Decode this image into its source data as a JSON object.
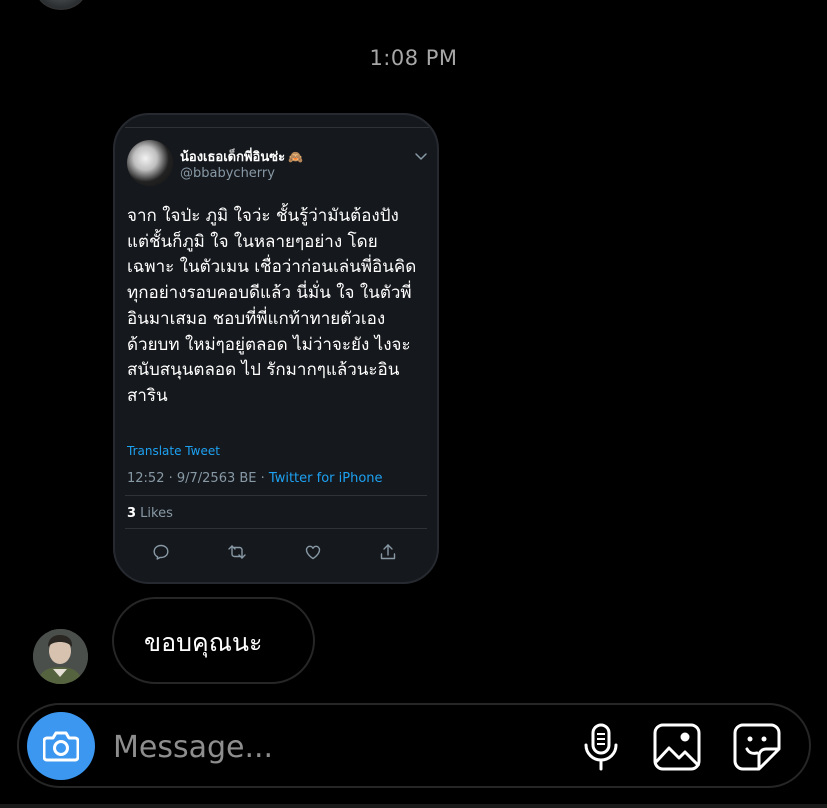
{
  "conversation": {
    "timestamp": "1:08 PM"
  },
  "shared_tweet": {
    "display_name": "น้องเธอเด็กพี่อินซ่ะ",
    "name_emoji": "🙈",
    "handle": "@bbabycherry",
    "text_lines": [
      "จาก ใจป่ะ ภูมิ ใจว่ะ ชั้นรู้ว่ามันต้องปัง",
      "แต่ชั้นก็ภูมิ ใจ ในหลายๆอย่าง โดย",
      "เฉพาะ ในตัวเมน เชื่อว่าก่อนเล่นพี่อินคิด",
      "ทุกอย่างรอบคอบดีแล้ว นี่มั่น ใจ ในตัวพี่",
      "อินมาเสมอ ชอบที่พี่แกท้าทายตัวเอง",
      "ด้วยบท ใหม่ๆอยู่ตลอด ไม่ว่าจะยัง ไงจะ",
      "สนับสนุนตลอด ไป รักมากๆแล้วนะอิน",
      "สาริน"
    ],
    "translate_label": "Translate Tweet",
    "meta_time": "12:52 · 9/7/2563 BE · ",
    "meta_source": "Twitter for iPhone",
    "likes_count": "3",
    "likes_label": " Likes",
    "icons": {
      "options": "chevron-down-icon",
      "reply": "reply-icon",
      "retweet": "retweet-icon",
      "like": "heart-icon",
      "share": "share-icon"
    },
    "colors": {
      "card_background": "#15181c",
      "link": "#1da1f2",
      "secondary_text": "#8899a6"
    }
  },
  "reply_message": {
    "text": "ขอบคุณนะ"
  },
  "composer": {
    "placeholder": "Message...",
    "icons": {
      "camera": "camera-icon",
      "voice": "microphone-icon",
      "gallery": "gallery-icon",
      "sticker": "sticker-icon"
    },
    "camera_color": "#3b97f0"
  }
}
